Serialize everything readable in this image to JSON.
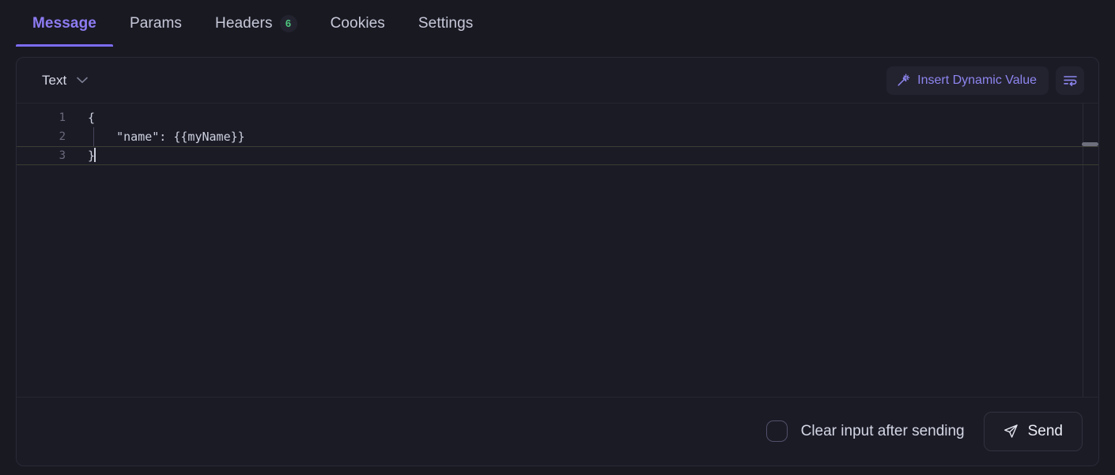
{
  "tabs": [
    {
      "id": "message",
      "label": "Message",
      "active": true,
      "badge": null
    },
    {
      "id": "params",
      "label": "Params",
      "active": false,
      "badge": null
    },
    {
      "id": "headers",
      "label": "Headers",
      "active": false,
      "badge": "6"
    },
    {
      "id": "cookies",
      "label": "Cookies",
      "active": false,
      "badge": null
    },
    {
      "id": "settings",
      "label": "Settings",
      "active": false,
      "badge": null
    }
  ],
  "editor": {
    "type_select": {
      "value": "Text",
      "icon": "chevron-down-icon"
    },
    "insert_dynamic_value": {
      "label": "Insert Dynamic Value",
      "icon": "magic-wand-icon"
    },
    "wrap_button": {
      "icon": "word-wrap-icon"
    },
    "lines": [
      {
        "number": "1",
        "text": "{",
        "active": false,
        "indent_guide": false
      },
      {
        "number": "2",
        "text": "    \"name\": {{myName}}",
        "active": false,
        "indent_guide": true
      },
      {
        "number": "3",
        "text": "}",
        "active": true,
        "indent_guide": false
      }
    ]
  },
  "footer": {
    "clear_input": {
      "label": "Clear input after sending",
      "checked": false
    },
    "send": {
      "label": "Send",
      "icon": "send-icon"
    }
  },
  "colors": {
    "accent": "#7c6cf0",
    "accent_text": "#8d7bf2",
    "badge_text": "#4ec77f",
    "panel_bg": "#1b1b26",
    "page_bg": "#191922",
    "border": "#2a2a38",
    "text_primary": "#d3d6e4",
    "text_muted": "#6a6a7d"
  }
}
